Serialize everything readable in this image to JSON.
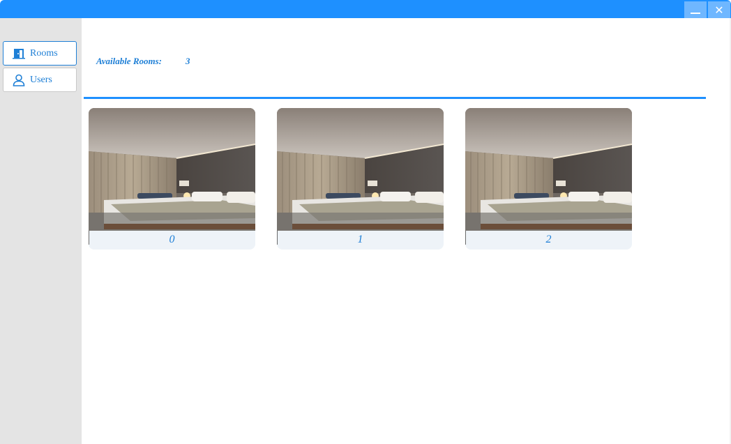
{
  "window": {
    "minimize_icon": "minimize-icon",
    "close_icon": "close-icon",
    "close_glyph": "✕"
  },
  "sidebar": {
    "items": [
      {
        "label": "Rooms",
        "icon": "door-icon",
        "active": true
      },
      {
        "label": "Users",
        "icon": "user-icon",
        "active": false
      }
    ]
  },
  "header": {
    "label": "Available Rooms:",
    "count": "3"
  },
  "rooms": [
    {
      "number": "0",
      "image": "hotel-room-photo"
    },
    {
      "number": "1",
      "image": "hotel-room-photo"
    },
    {
      "number": "2",
      "image": "hotel-room-photo"
    }
  ],
  "colors": {
    "accent": "#1e90ff",
    "text_accent": "#1e7fd6",
    "sidebar_bg": "#e4e4e4",
    "card_bg": "#eef3f8"
  }
}
